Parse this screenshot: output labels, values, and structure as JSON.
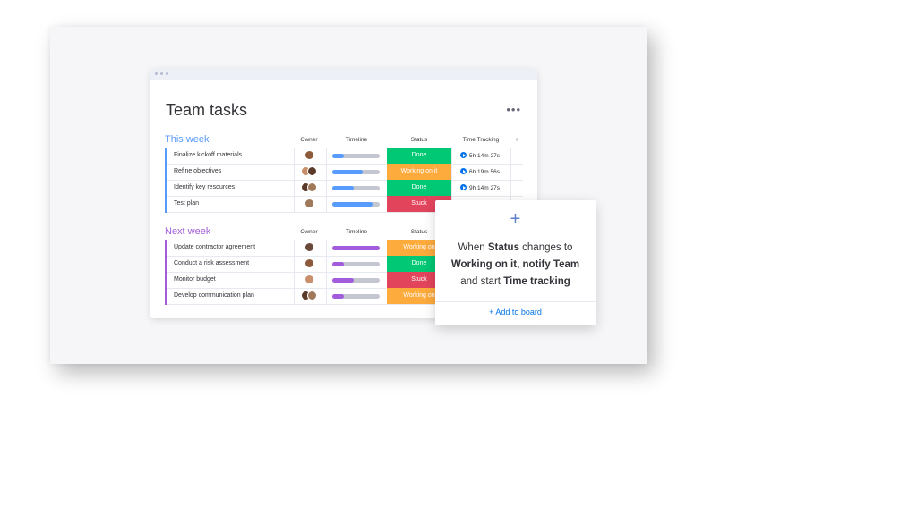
{
  "board": {
    "title": "Team tasks",
    "more_icon": "ellipsis-icon",
    "columns": {
      "owner": "Owner",
      "timeline": "Timeline",
      "status": "Status",
      "time_tracking": "Time Tracking",
      "add": "+"
    },
    "groups": [
      {
        "title": "This week",
        "color": "#579bfc",
        "rows": [
          {
            "task": "Finalize kickoff materials",
            "owners": 1,
            "timeline": 0.25,
            "status": "Done",
            "status_color": "#00c875",
            "time": "5h 14m 27s"
          },
          {
            "task": "Refine objectives",
            "owners": 2,
            "timeline": 0.65,
            "status": "Working on it",
            "status_color": "#fdab3d",
            "time": "6h 19m 56s"
          },
          {
            "task": "Identify key resources",
            "owners": 2,
            "timeline": 0.45,
            "status": "Done",
            "status_color": "#00c875",
            "time": "9h 14m 27s"
          },
          {
            "task": "Test plan",
            "owners": 1,
            "timeline": 0.85,
            "status": "Stuck",
            "status_color": "#e2445c",
            "time": ""
          }
        ]
      },
      {
        "title": "Next week",
        "color": "#a25ddc",
        "rows": [
          {
            "task": "Update contractor agreement",
            "owners": 1,
            "timeline": 1.0,
            "status": "Working on",
            "status_color": "#fdab3d",
            "time": ""
          },
          {
            "task": "Conduct a risk assessment",
            "owners": 1,
            "timeline": 0.25,
            "status": "Done",
            "status_color": "#00c875",
            "time": ""
          },
          {
            "task": "Monitor budget",
            "owners": 1,
            "timeline": 0.45,
            "status": "Stuck",
            "status_color": "#e2445c",
            "time": ""
          },
          {
            "task": "Develop communication plan",
            "owners": 2,
            "timeline": 0.25,
            "status": "Working on",
            "status_color": "#fdab3d",
            "time": ""
          }
        ]
      }
    ]
  },
  "automation": {
    "plus": "+",
    "line1_pre": "When ",
    "line1_bold": "Status",
    "line1_post": " changes to",
    "line2_bold": "Working on it, notify Team",
    "line3_pre": "and start ",
    "line3_bold": "Time tracking",
    "add_label": "+ Add to board"
  }
}
